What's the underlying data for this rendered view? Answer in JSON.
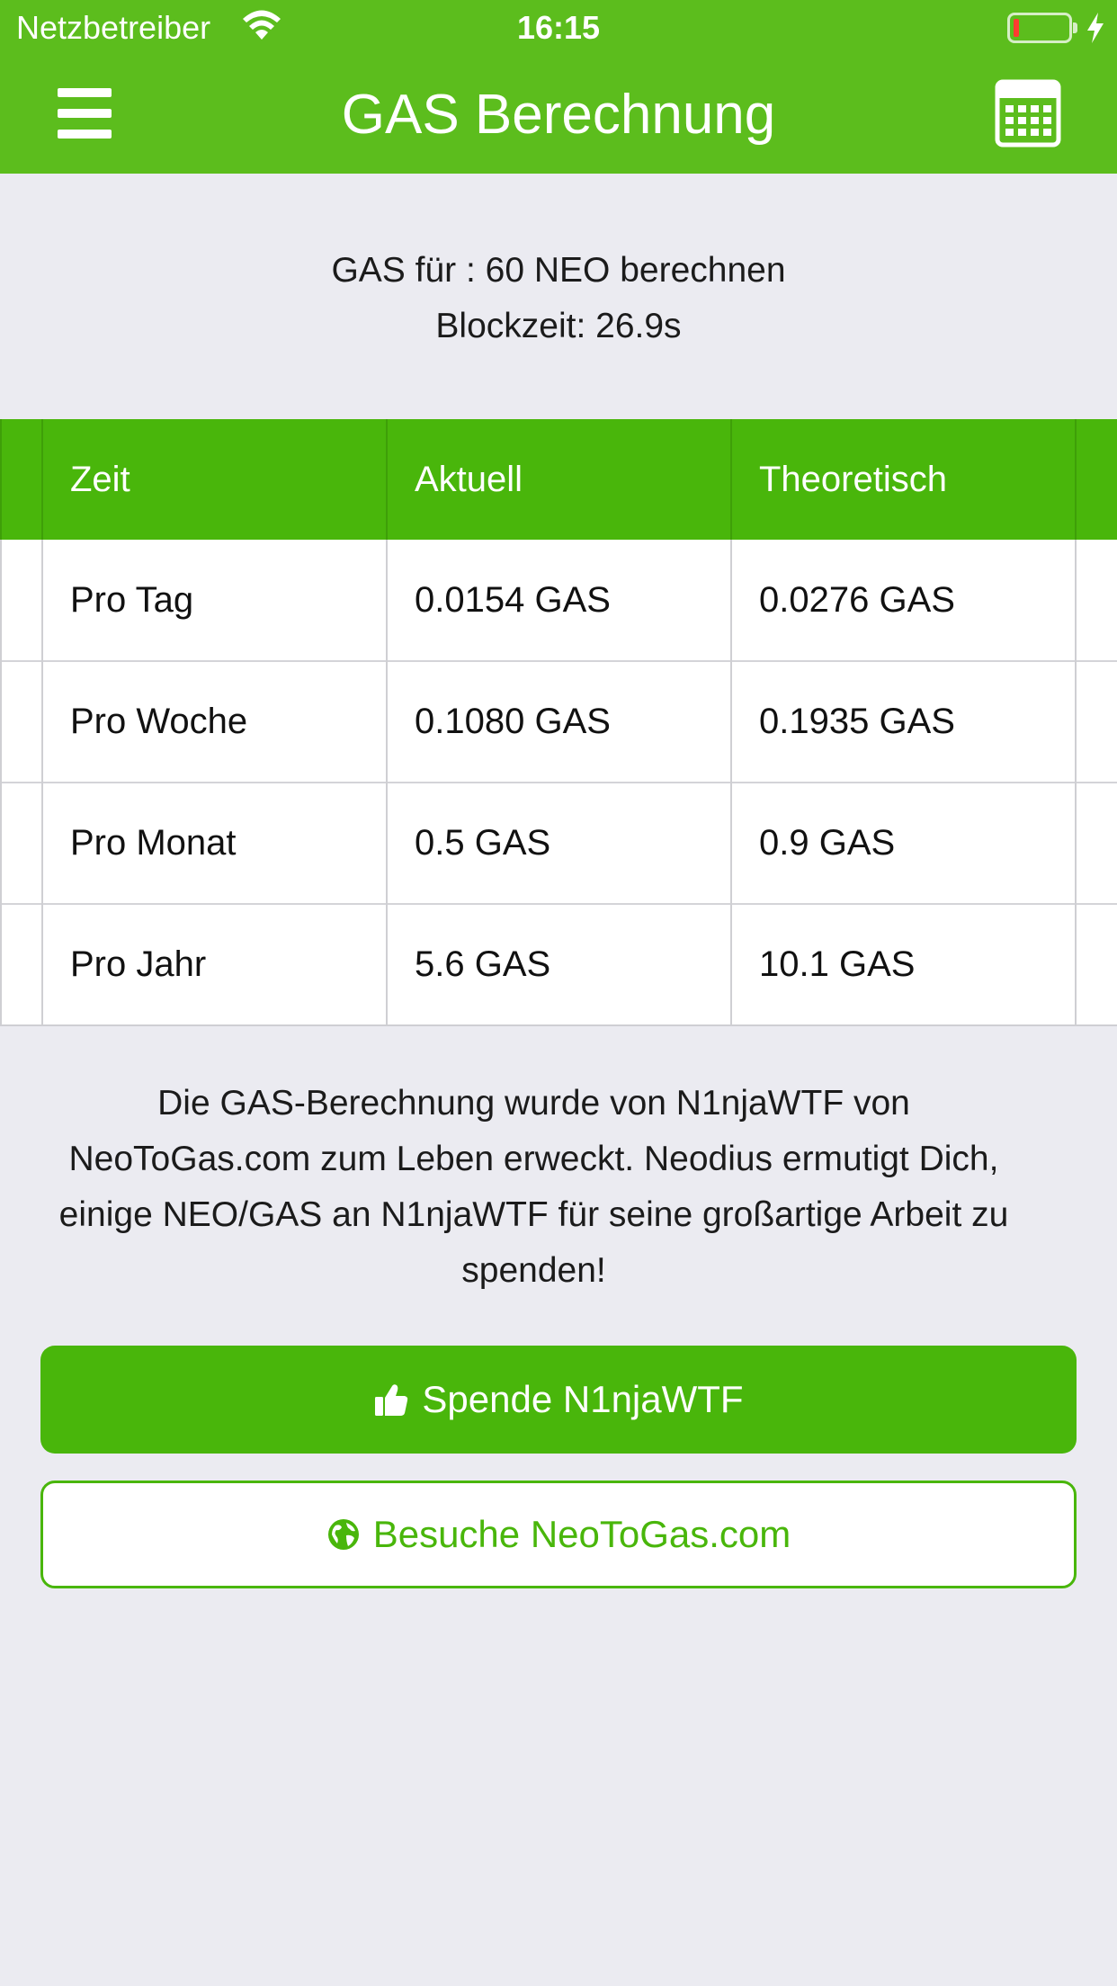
{
  "status_bar": {
    "carrier": "Netzbetreiber",
    "time": "16:15",
    "battery_level_percent": 10
  },
  "header": {
    "title": "GAS Berechnung",
    "left_icon": "hamburger-menu-icon",
    "right_icon": "calculator-icon"
  },
  "info": {
    "line1": "GAS für : 60 NEO berechnen",
    "line2": "Blockzeit: 26.9s"
  },
  "table": {
    "headers": [
      "Zeit",
      "Aktuell",
      "Theoretisch"
    ],
    "rows": [
      [
        "Pro Tag",
        "0.0154 GAS",
        "0.0276 GAS"
      ],
      [
        "Pro Woche",
        "0.1080 GAS",
        "0.1935 GAS"
      ],
      [
        "Pro Monat",
        "0.5 GAS",
        "0.9 GAS"
      ],
      [
        "Pro Jahr",
        "5.6 GAS",
        "10.1 GAS"
      ]
    ]
  },
  "credit": {
    "text": "Die GAS-Berechnung wurde von N1njaWTF von NeoToGas.com zum Leben erweckt. Neodius ermutigt Dich, einige NEO/GAS an N1njaWTF für seine großartige Arbeit zu spenden!"
  },
  "buttons": {
    "donate_label": "Spende N1njaWTF",
    "donate_icon": "thumbs-up-icon",
    "visit_label": "Besuche NeoToGas.com",
    "visit_icon": "globe-icon"
  },
  "colors": {
    "header_green": "#5cbd1d",
    "accent_green": "#49b60b",
    "background": "#ebebf1"
  }
}
